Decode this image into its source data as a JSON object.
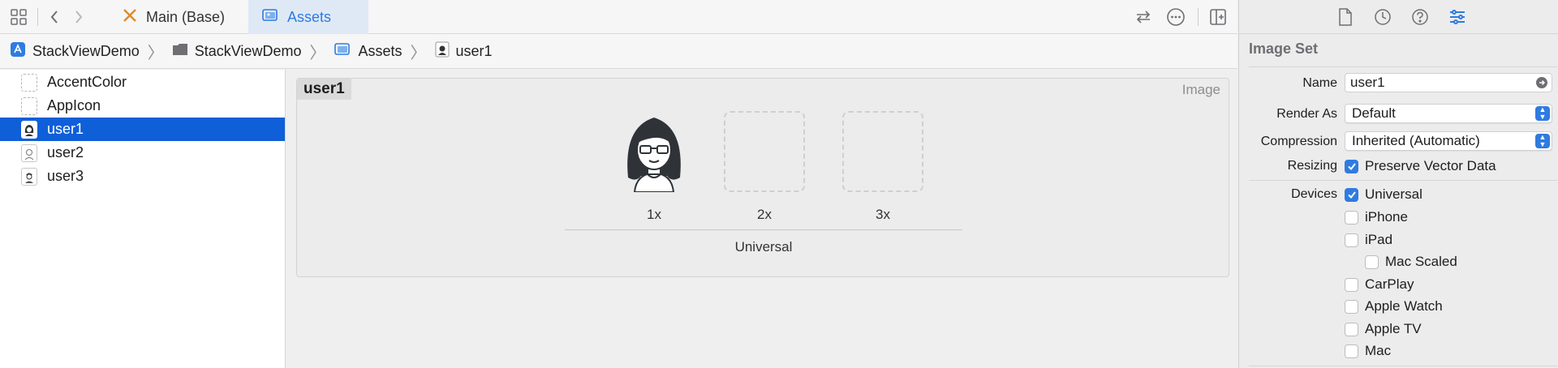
{
  "tabbar": {
    "tabs": [
      {
        "label": "Main (Base)",
        "icon": "interface-builder-icon",
        "active": false
      },
      {
        "label": "Assets",
        "icon": "asset-catalog-icon",
        "active": true
      }
    ]
  },
  "breadcrumb": [
    {
      "label": "StackViewDemo",
      "icon": "app-project-icon"
    },
    {
      "label": "StackViewDemo",
      "icon": "folder-icon"
    },
    {
      "label": "Assets",
      "icon": "asset-catalog-icon"
    },
    {
      "label": "user1",
      "icon": "image-set-icon"
    }
  ],
  "navigator": {
    "items": [
      {
        "label": "AccentColor",
        "kind": "color",
        "selected": false
      },
      {
        "label": "AppIcon",
        "kind": "appicon",
        "selected": false
      },
      {
        "label": "user1",
        "kind": "image",
        "selected": true
      },
      {
        "label": "user2",
        "kind": "image",
        "selected": false
      },
      {
        "label": "user3",
        "kind": "image",
        "selected": false
      }
    ]
  },
  "asset": {
    "name": "user1",
    "kind": "Image",
    "slots": [
      "1x",
      "2x",
      "3x"
    ],
    "group_label": "Universal"
  },
  "inspector": {
    "section_title": "Image Set",
    "name_label": "Name",
    "name_value": "user1",
    "render_as_label": "Render As",
    "render_as_value": "Default",
    "compression_label": "Compression",
    "compression_value": "Inherited (Automatic)",
    "resizing_label": "Resizing",
    "resizing_option": {
      "label": "Preserve Vector Data",
      "checked": true
    },
    "devices_label": "Devices",
    "devices": [
      {
        "label": "Universal",
        "checked": true
      },
      {
        "label": "iPhone",
        "checked": false
      },
      {
        "label": "iPad",
        "checked": false
      },
      {
        "label": "Mac Scaled",
        "checked": false
      },
      {
        "label": "CarPlay",
        "checked": false
      },
      {
        "label": "Apple Watch",
        "checked": false
      },
      {
        "label": "Apple TV",
        "checked": false
      },
      {
        "label": "Mac",
        "checked": false
      }
    ]
  },
  "colors": {
    "accent": "#2f7be0",
    "selection": "#0f5fd9"
  }
}
